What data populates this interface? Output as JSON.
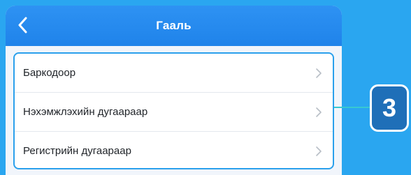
{
  "header": {
    "title": "Гааль",
    "back_icon": "chevron-left-icon"
  },
  "menu": {
    "items": [
      {
        "label": "Баркодоор",
        "icon": "chevron-right-icon"
      },
      {
        "label": "Нэхэмжлэхийн дугаараар",
        "icon": "chevron-right-icon"
      },
      {
        "label": "Регистрийн дугаараар",
        "icon": "chevron-right-icon"
      }
    ]
  },
  "callout": {
    "number": "3"
  },
  "colors": {
    "background": "#2aa6f0",
    "navbar": "#1f83ea",
    "highlight_border": "#2aa0ec",
    "badge": "#1f6fb8",
    "connector": "#38c8d2"
  }
}
